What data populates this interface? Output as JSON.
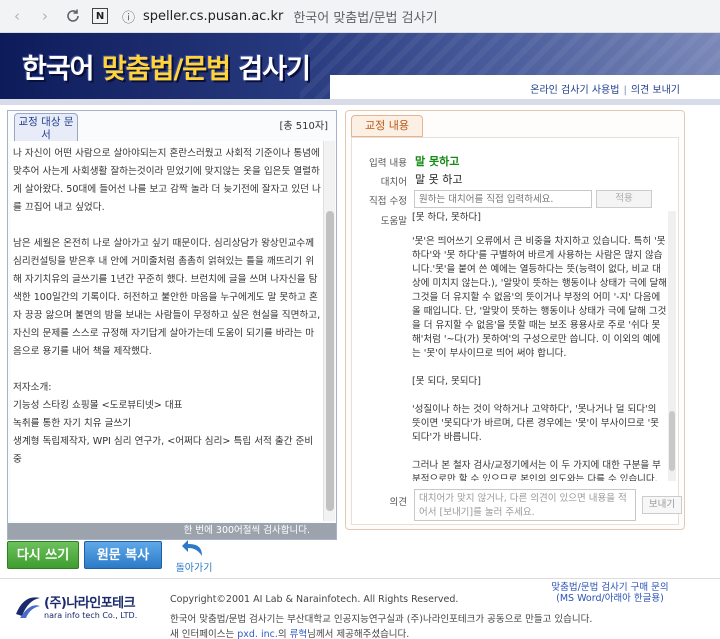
{
  "browser": {
    "url": "speller.cs.pusan.ac.kr",
    "tab_title": "한국어 맞춤법/문법 검사기",
    "ext_label": "N"
  },
  "banner": {
    "title_part1": "한국어 ",
    "title_part2": "맞춤법/문법",
    "title_part3": " 검사기",
    "link_help": "온라인 검사기 사용법",
    "link_feedback": "의견 보내기",
    "separator": "|"
  },
  "left": {
    "tab_label": "교정 대상 문서",
    "char_count": "[총 510자]",
    "limit_note": "한 번에 300어절씩 검사합니다.",
    "paragraphs": [
      "나 자신이 어떤 사람으로 살아야되는지 혼란스러웠고 사회적 기준이나 통념에 맞추어 사는게 사회생활 잘하는것이라 믿었기에 맞지않는 옷을 입은듯 열렬하게 살아왔다.  50대에 들어선 나를 보고 감짝 놀라 더 늦기전에 잘자고 있던 나를 끄집어 내고 싶었다.",
      "남은 세월은 온전히 나로 살아가고 싶기 때문이다. 심리상담가 왕상민교수께 심리컨설팅을 받은후 내 안에 거미줄처럼 촘촘히 얽혀있는 틀을 깨뜨리기 위해 자기치유의 글쓰기를 1년간 꾸준히 했다.  브런치에 글을 쓰며 나자신을 탐색한 100일간의 기록이다.  허전하고 불안한 마음을 누구에게도 말 못하고 혼자 끙끙 앓으며 불면의 밤을 보내는 사람들이 무정하고 싶은 현실을 직면하고, 자신의 문제를 스스로 규정해 자기답게 살아가는데 도움이 되기를 바라는 마음으로 용기를 내어 책을 제작했다.",
      "저자소개:",
      "기능성 스타킹 쇼핑몰 <도로뷰티넷> 대표",
      "녹취를 통한 자기 치유 글쓰기",
      "생계형 독립제작자, WPI 심리 연구가, <어쩌다 심리> 특립 서적 출간 준비 중"
    ]
  },
  "right": {
    "tab_label": "교정 내용",
    "label_input": "입력 내용",
    "input_value": "말 못하고",
    "label_replace": "대치어",
    "replace_value": "말 못 하고",
    "label_direct": "직접 수정",
    "direct_placeholder": "원하는 대치어를 직접 입력하세요.",
    "apply_label": "적용",
    "label_help": "도움말",
    "help_first": "[못 하다, 못하다]",
    "help_paragraphs": [
      "'못'은 띄어쓰기 오류에서 큰 비중을 차지하고 있습니다. 특히 '못하다'와 '못 하다'를 구별하여 바르게 사용하는 사람은 많지 않습니다.'못'을 붙여 쓴 예에는 열등하다는 뜻(능력이 없다, 비교 대상에 미치지 않는다.), '알맞이 뜻하는 행동이나 상태가 극에 달해 그것을 더 유지할 수 없음'의 뜻이거나 부정의 어미 '-지' 다음에 올 때입니다. 단, '알맞이 뜻하는 행동이나 상태가 극에 달해 그것을 더 유지할 수 없음'을 뜻할 때는 보조 용용사로 주로 '쉬다 못해'처럼 '~다(가) 못하여'의 구성으로만 씁니다. 이 이외의 예에는 '못'이 부사이므로 띄어 써야 합니다.",
      "[못 되다, 못되다]",
      "'성질이나 하는 것이 악하거나 고약하다', '못나거나 덜 되다'의 뜻이면 '못되다'가 바르며, 다른 경우에는 '못'이 부사이므로 '못 되다'가 바릅니다.",
      "그러나 본 철자 검사/교정기에서는 이 두 가지에 대한 구분을 부분적으로만 할 수 있으므로 본인의 의도와는 다를 수 있습니다."
    ],
    "label_opinion": "의견",
    "opinion_placeholder": "대치어가 맞지 않거나, 다른 의견이 있으면 내용을 적어서 [보내기]를 눌러 주세요.",
    "send_label": "보내기"
  },
  "actions": {
    "retry": "다시 쓰기",
    "copy": "원문 복사",
    "back": "돌아가기"
  },
  "footer": {
    "logo_name": "(주)나라인포테크",
    "logo_sub": "nara info tech Co., LTD.",
    "copyright": "Copyright©2001 AI Lab & Narainfotech. All Rights Reserved.",
    "line2": "한국어 맞춤법/문법 검사기는 부산대학교 인공지능연구실과 (주)나라인포테크가 공동으로 만들고 있습니다.",
    "line3_prefix": "새 인터페이스는 ",
    "line3_link1": "pxd. inc.",
    "line3_mid": "의 ",
    "line3_link2": "류혁",
    "line3_suffix": "님께서 제공해주셨습니다.",
    "purchase_line1": "맞춤법/문법 검사기 구매 문의",
    "purchase_line2": "(MS Word/아래아 한글용)"
  },
  "colors": {
    "banner_dark": "#0d1b5a",
    "accent_yellow": "#ffd43b",
    "green_button": "#3f9d2f",
    "blue_button": "#2c7ac7",
    "input_green": "#138a13"
  }
}
